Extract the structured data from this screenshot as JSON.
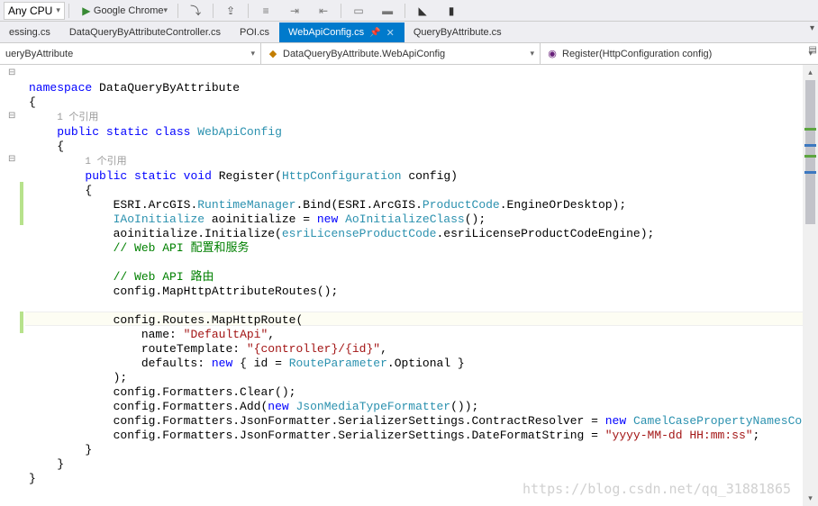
{
  "toolbar": {
    "config": "Any CPU",
    "browser": "Google Chrome"
  },
  "tabs": {
    "t0": "essing.cs",
    "t1": "DataQueryByAttributeController.cs",
    "t2": "POI.cs",
    "t3": "WebApiConfig.cs",
    "t4": "QueryByAttribute.cs"
  },
  "nav": {
    "ns": "ueryByAttribute",
    "cls": "DataQueryByAttribute.WebApiConfig",
    "mth": "Register(HttpConfiguration config)"
  },
  "ref": "1 个引用",
  "code": {
    "ns_kw": "namespace",
    "ns_name": " DataQueryByAttribute",
    "brace_o": "{",
    "pub": "public",
    "stat": "static",
    "cls_kw": "class",
    "cls_name": "WebApiConfig",
    "void_kw": "void",
    "reg": "Register",
    "httpcfg": "HttpConfiguration",
    "cfg": " config",
    "line1a": "ESRI.ArcGIS.",
    "line1b": "RuntimeManager",
    "line1c": ".Bind(ESRI.ArcGIS.",
    "line1d": "ProductCode",
    "line1e": ".EngineOrDesktop);",
    "line2a": "IAoInitialize",
    "line2b": " aoinitialize = ",
    "new_kw": "new",
    "line2c": "AoInitializeClass",
    "line2d": "();",
    "line3a": "aoinitialize.Initialize(",
    "line3b": "esriLicenseProductCode",
    "line3c": ".esriLicenseProductCodeEngine);",
    "cmt1": "// Web API 配置和服务",
    "cmt2": "// Web API 路由",
    "line4": "config.MapHttpAttributeRoutes();",
    "line5": "config.Routes.MapHttpRoute(",
    "name_lbl": "name",
    "name_val": "\"DefaultApi\"",
    "route_lbl": "routeTemplate",
    "route_val": "\"{controller}/{id}\"",
    "def_lbl": "defaults",
    "id_eq": " { id = ",
    "routeparam": "RouteParameter",
    "opt": ".Optional }",
    "close_paren": ");",
    "line6": "config.Formatters.Clear();",
    "line7a": "config.Formatters.Add(",
    "line7b": "JsonMediaTypeFormatter",
    "line7c": "());",
    "line8a": "config.Formatters.JsonFormatter.SerializerSettings.ContractResolver = ",
    "line8b": "CamelCasePropertyNamesContractResol",
    "line9a": "config.Formatters.JsonFormatter.SerializerSettings.DateFormatString = ",
    "line9b": "\"yyyy-MM-dd HH:mm:ss\"",
    "semi": ";",
    "brace_c": "}"
  },
  "watermark": "https://blog.csdn.net/qq_31881865"
}
